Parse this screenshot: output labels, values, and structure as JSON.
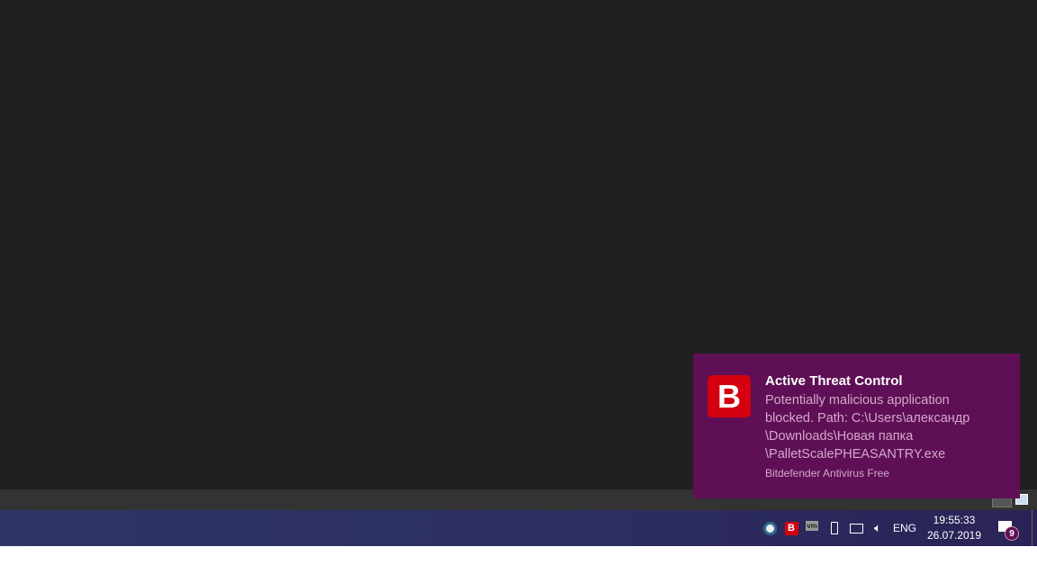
{
  "notification": {
    "title": "Active Threat Control",
    "body_lines": [
      "Potentially malicious application",
      "blocked. Path: C:\\Users\\александр",
      "\\Downloads\\Новая папка",
      "\\PalletScalePHEASANTRY.exe"
    ],
    "source": "Bitdefender Antivirus Free",
    "logo_letter": "B"
  },
  "taskbar": {
    "tray_icons": [
      "yandex-icon",
      "bitdefender-icon",
      "vmware-icon",
      "usb-eject-icon",
      "network-icon",
      "volume-icon"
    ],
    "bitdefender_letter": "B",
    "vmware_label": "vm",
    "language": "ENG",
    "time": "19:55:33",
    "date": "26.07.2019",
    "notification_count": "9"
  },
  "colors": {
    "toast_bg": "#5e0f55",
    "brand_red": "#d5000f",
    "taskbar": "#2c2d60"
  }
}
